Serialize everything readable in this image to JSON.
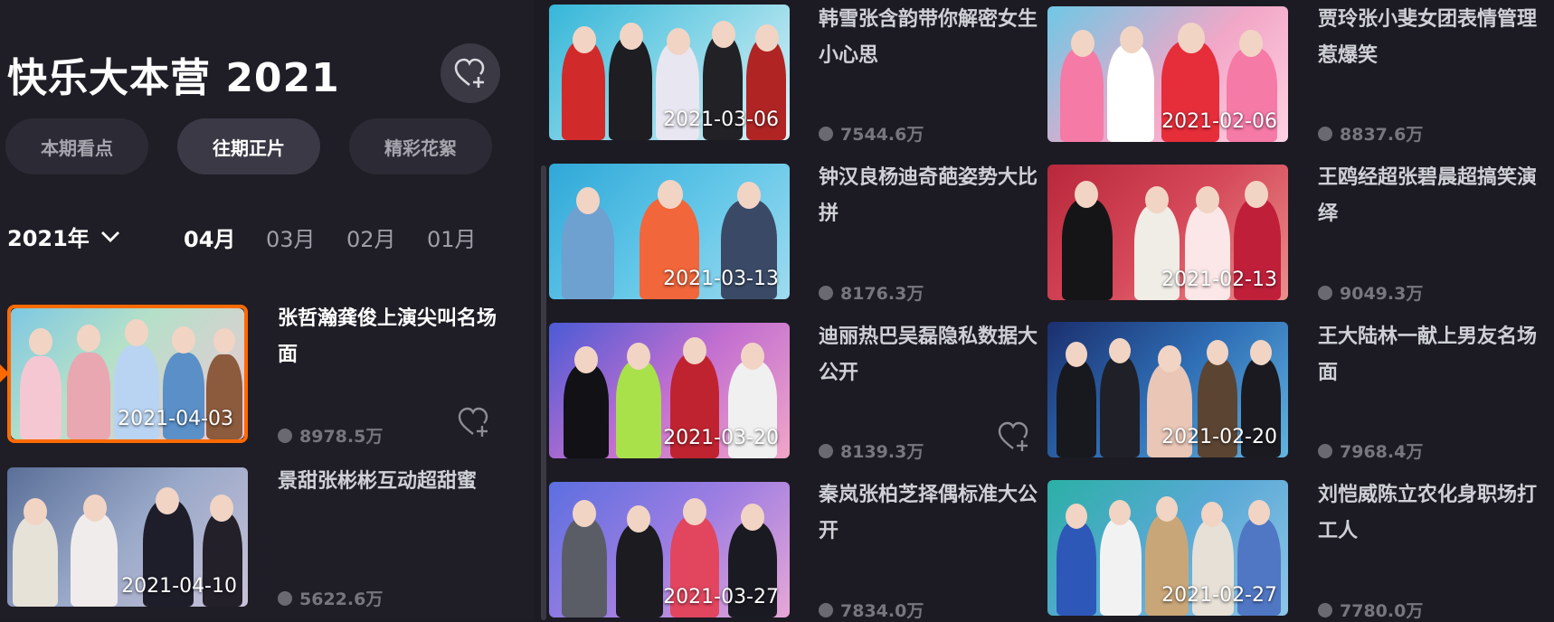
{
  "show_title": "快乐大本营 2021",
  "tabs": [
    {
      "label": "本期看点",
      "active": false
    },
    {
      "label": "往期正片",
      "active": true
    },
    {
      "label": "精彩花絮",
      "active": false
    }
  ],
  "year_selector": "2021年",
  "months": [
    {
      "label": "04月",
      "active": true
    },
    {
      "label": "03月",
      "active": false
    },
    {
      "label": "02月",
      "active": false
    },
    {
      "label": "01月",
      "active": false
    }
  ],
  "left_episodes": [
    {
      "title": "张哲瀚龚俊上演尖叫名场面",
      "date": "2021-04-03",
      "views": "8978.5万",
      "selected": true
    },
    {
      "title": "景甜张彬彬互动超甜蜜",
      "date": "2021-04-10",
      "views": "5622.6万",
      "selected": false
    }
  ],
  "middle_episodes": [
    {
      "title": "韩雪张含韵带你解密女生小心思",
      "date": "2021-03-06",
      "views": "7544.6万"
    },
    {
      "title": "钟汉良杨迪奇葩姿势大比拼",
      "date": "2021-03-13",
      "views": "8176.3万"
    },
    {
      "title": "迪丽热巴吴磊隐私数据大公开",
      "date": "2021-03-20",
      "views": "8139.3万"
    },
    {
      "title": "秦岚张柏芝择偶标准大公开",
      "date": "2021-03-27",
      "views": "7834.0万"
    }
  ],
  "right_episodes": [
    {
      "title": "贾玲张小斐女团表情管理惹爆笑",
      "date": "2021-02-06",
      "views": "8837.6万"
    },
    {
      "title": "王鸥经超张碧晨超搞笑演绎",
      "date": "2021-02-13",
      "views": "9049.3万"
    },
    {
      "title": "王大陆林一献上男友名场面",
      "date": "2021-02-20",
      "views": "7968.4万"
    },
    {
      "title": "刘恺威陈立农化身职场打工人",
      "date": "2021-02-27",
      "views": "7780.0万"
    }
  ],
  "colors": {
    "background": "#1c1b23",
    "accent_selected": "#ff6a00",
    "tab_active": "#3a3945"
  },
  "icons": [
    "heart-plus-icon",
    "chevron-down-icon",
    "play-dot-icon"
  ]
}
